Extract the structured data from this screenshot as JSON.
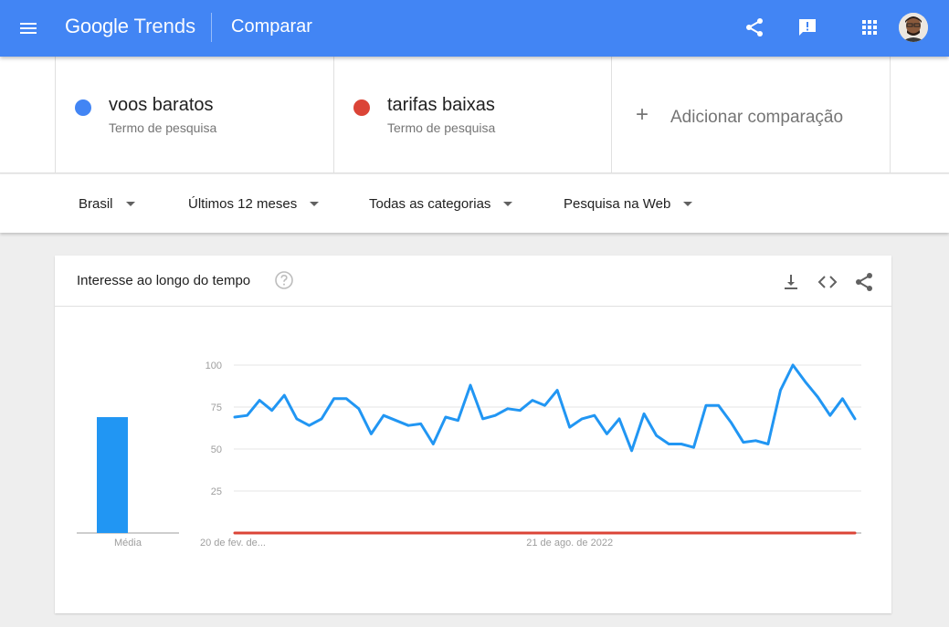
{
  "header": {
    "logo_google": "Google",
    "logo_trends": "Trends",
    "page_title": "Comparar"
  },
  "terms": [
    {
      "name": "voos baratos",
      "subtitle": "Termo de pesquisa",
      "color": "#4285f4"
    },
    {
      "name": "tarifas baixas",
      "subtitle": "Termo de pesquisa",
      "color": "#db4437"
    }
  ],
  "add_comparison": {
    "icon": "+",
    "label": "Adicionar comparação"
  },
  "filters": {
    "region": "Brasil",
    "period": "Últimos 12 meses",
    "category": "Todas as categorias",
    "search_type": "Pesquisa na Web"
  },
  "card": {
    "title": "Interesse ao longo do tempo"
  },
  "chart_data": {
    "type": "line",
    "y_ticks": [
      "100",
      "75",
      "50",
      "25"
    ],
    "ylim": [
      0,
      100
    ],
    "x_labels": [
      "20 de fev. de...",
      "21 de ago. de 2022"
    ],
    "x_label_index": [
      0,
      27
    ],
    "average_label": "Média",
    "averages": [
      69,
      0
    ],
    "series": [
      {
        "color": "#2196f3",
        "values": [
          69,
          70,
          79,
          73,
          82,
          68,
          64,
          68,
          80,
          80,
          74,
          59,
          70,
          67,
          64,
          65,
          53,
          69,
          67,
          88,
          68,
          70,
          74,
          73,
          79,
          76,
          85,
          63,
          68,
          70,
          59,
          68,
          49,
          71,
          58,
          53,
          53,
          51,
          76,
          76,
          66,
          54,
          55,
          53,
          85,
          100,
          90,
          81,
          70,
          80,
          68
        ]
      },
      {
        "color": "#db4437",
        "values": [
          0,
          0,
          0,
          0,
          0,
          0,
          0,
          0,
          0,
          0,
          0,
          0,
          0,
          0,
          0,
          0,
          0,
          0,
          0,
          0,
          0,
          0,
          0,
          0,
          0,
          0,
          0,
          0,
          0,
          0,
          0,
          0,
          0,
          0,
          0,
          0,
          0,
          0,
          0,
          0,
          0,
          0,
          0,
          0,
          0,
          0,
          0,
          0,
          0,
          0,
          0
        ]
      }
    ],
    "grid": true
  }
}
